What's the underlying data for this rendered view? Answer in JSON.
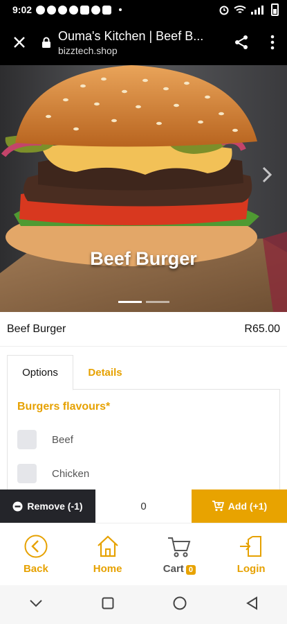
{
  "status_bar": {
    "time": "9:02"
  },
  "browser": {
    "title": "Ouma's Kitchen | Beef B...",
    "url": "bizztech.shop"
  },
  "hero": {
    "caption": "Beef Burger"
  },
  "product": {
    "name": "Beef Burger",
    "price": "R65.00"
  },
  "tabs": [
    {
      "label": "Options"
    },
    {
      "label": "Details"
    }
  ],
  "options": {
    "section_title": "Burgers flavours*",
    "items": [
      {
        "label": "Beef"
      },
      {
        "label": "Chicken"
      }
    ]
  },
  "actions": {
    "remove_label": "Remove (-1)",
    "quantity": "0",
    "add_label": "Add (+1)"
  },
  "bottom_nav": {
    "items": [
      {
        "label": "Back"
      },
      {
        "label": "Home"
      },
      {
        "label": "Cart"
      },
      {
        "label": "Login"
      }
    ],
    "cart_count": "0"
  },
  "colors": {
    "accent": "#e8a300",
    "dark_button": "#24252a",
    "checkbox": "#e5e6ea"
  }
}
